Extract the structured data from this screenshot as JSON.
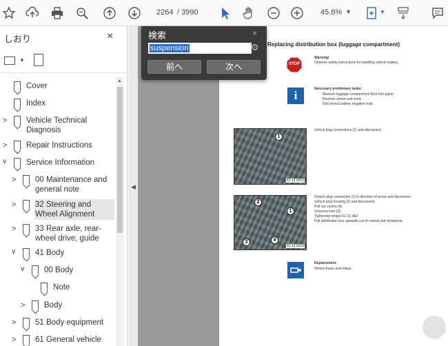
{
  "toolbar": {
    "page_current": "2264",
    "page_total": "/ 3990",
    "zoom": "45.6%",
    "icons": [
      "star-icon",
      "upload-icon",
      "print-icon",
      "zoom-search-icon",
      "page-up-icon",
      "page-down-icon",
      "cursor-icon",
      "hand-icon",
      "zoom-out-icon",
      "zoom-in-icon",
      "fit-page-icon",
      "scroll-mode-icon",
      "comment-icon"
    ]
  },
  "sidebar": {
    "title": "しおり",
    "close": "×",
    "bookmarks": [
      {
        "label": "Cover"
      },
      {
        "label": "Index"
      },
      {
        "label": "Vehicle Technical Diagnosis"
      },
      {
        "label": "Repair Instructions"
      },
      {
        "label": "Service Information"
      },
      {
        "label": "00 Maintenance and general note"
      },
      {
        "label": "32 Steering and Wheel Alignment"
      },
      {
        "label": "33 Rear axle, rear-wheel drive, guide"
      },
      {
        "label": "41 Body"
      },
      {
        "label": "00 Body"
      },
      {
        "label": "Note"
      },
      {
        "label": "Body"
      },
      {
        "label": "51 Body equipment"
      },
      {
        "label": "61 General vehicle"
      }
    ]
  },
  "search": {
    "title": "検索",
    "close": "×",
    "value": "suspension",
    "prev_label": "前へ",
    "next_label": "次へ"
  },
  "document": {
    "title": "Replacing distribution box (luggage compartment)",
    "warning_title": "Warning!",
    "warning_text": "Observe safety instructions for handling vehicle battery.",
    "stop_label": "STOP",
    "info_title": "Necessary preliminary tasks:",
    "info_items": [
      "Remove luggage compartment floor trim panel",
      "Remove centre unit cover",
      "Disconnect battery negative lead"
    ],
    "step1": "Unlock plug connections (1) and disconnect.",
    "step2": [
      "Detach plug connection (1) in direction of arrow and disconnect.",
      "Unlock plug housing (2) and disconnect.",
      "Pull out covers (4).",
      "Unscrew nuts (3).",
      "Tightening torque 61 21 3AZ.",
      "Pull distribution box upwards out of central unit receptacle."
    ],
    "replacement_title": "Replacement:",
    "replacement_text": "Renew fuses and relays.",
    "photo1_tag": "61 13 0215",
    "photo2_tag": "61 13 0216"
  }
}
